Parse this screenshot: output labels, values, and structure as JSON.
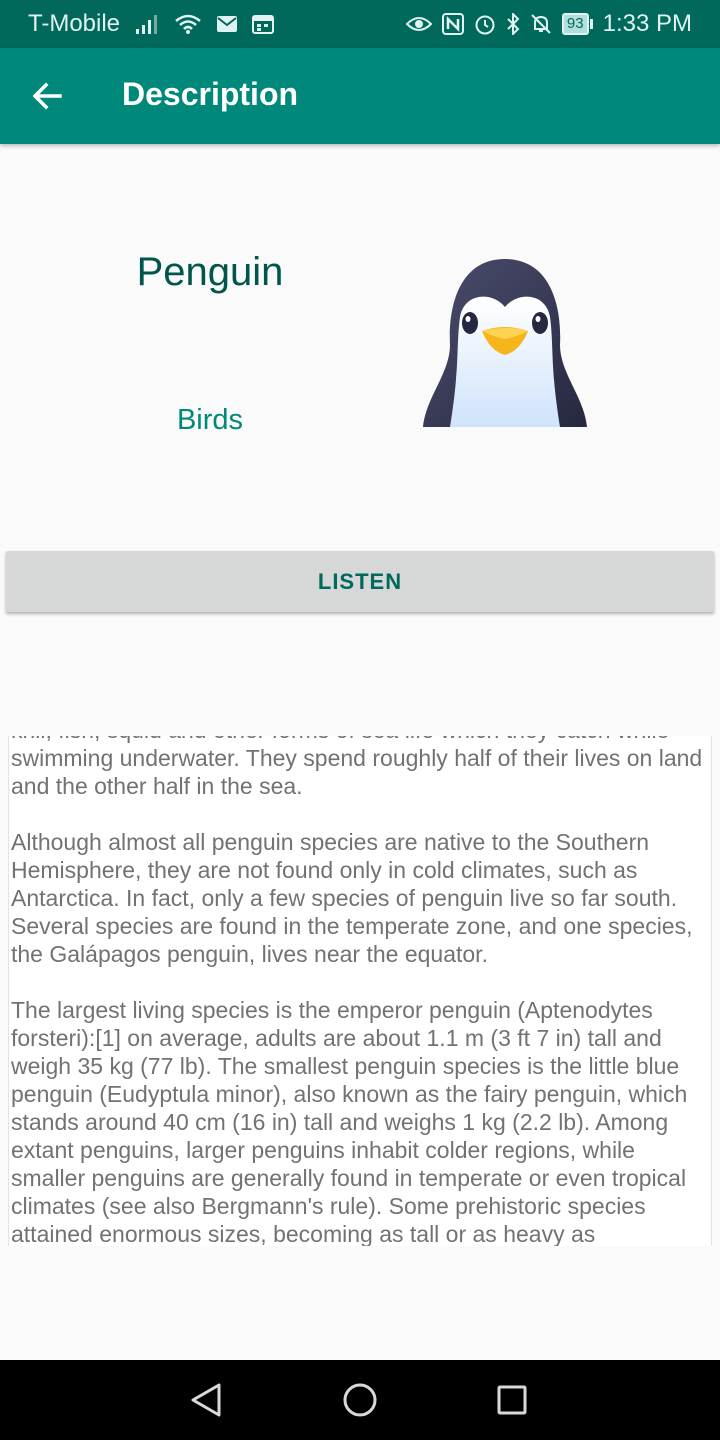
{
  "status_bar": {
    "carrier": "T-Mobile",
    "battery": "93",
    "time": "1:33 PM",
    "icons": [
      "signal-icon",
      "wifi-icon",
      "mail-icon",
      "calendar-icon",
      "eye-icon",
      "nfc-icon",
      "alarm-icon",
      "bluetooth-icon",
      "mute-icon",
      "battery-icon"
    ]
  },
  "app_bar": {
    "title": "Description",
    "back_icon": "back-arrow-icon"
  },
  "animal": {
    "name": "Penguin",
    "category": "Birds",
    "image_icon": "penguin-icon"
  },
  "listen_button": {
    "label": "LISTEN"
  },
  "description": {
    "paragraphs": [
      "krill, fish, squid and other forms of sea life which they catch while swimming underwater. They spend roughly half of their lives on land and the other half in the sea.",
      "Although almost all penguin species are native to the Southern Hemisphere, they are not found only in cold climates, such as Antarctica. In fact, only a few species of penguin live so far south. Several species are found in the temperate zone, and one species, the Galápagos penguin, lives near the equator.",
      "The largest living species is the emperor penguin (Aptenodytes forsteri):[1] on average, adults are about 1.1 m (3 ft 7 in) tall and weigh 35 kg (77 lb). The smallest penguin species is the little blue penguin (Eudyptula minor), also known as the fairy penguin, which stands around 40 cm (16 in) tall and weighs 1 kg (2.2 lb). Among extant penguins, larger penguins inhabit colder regions, while smaller penguins are generally found in temperate or even tropical climates (see also Bergmann's rule). Some prehistoric species attained enormous sizes, becoming as tall or as heavy as"
    ]
  },
  "nav_bar": {
    "icons": [
      "back-triangle-icon",
      "home-circle-icon",
      "recents-square-icon"
    ]
  }
}
